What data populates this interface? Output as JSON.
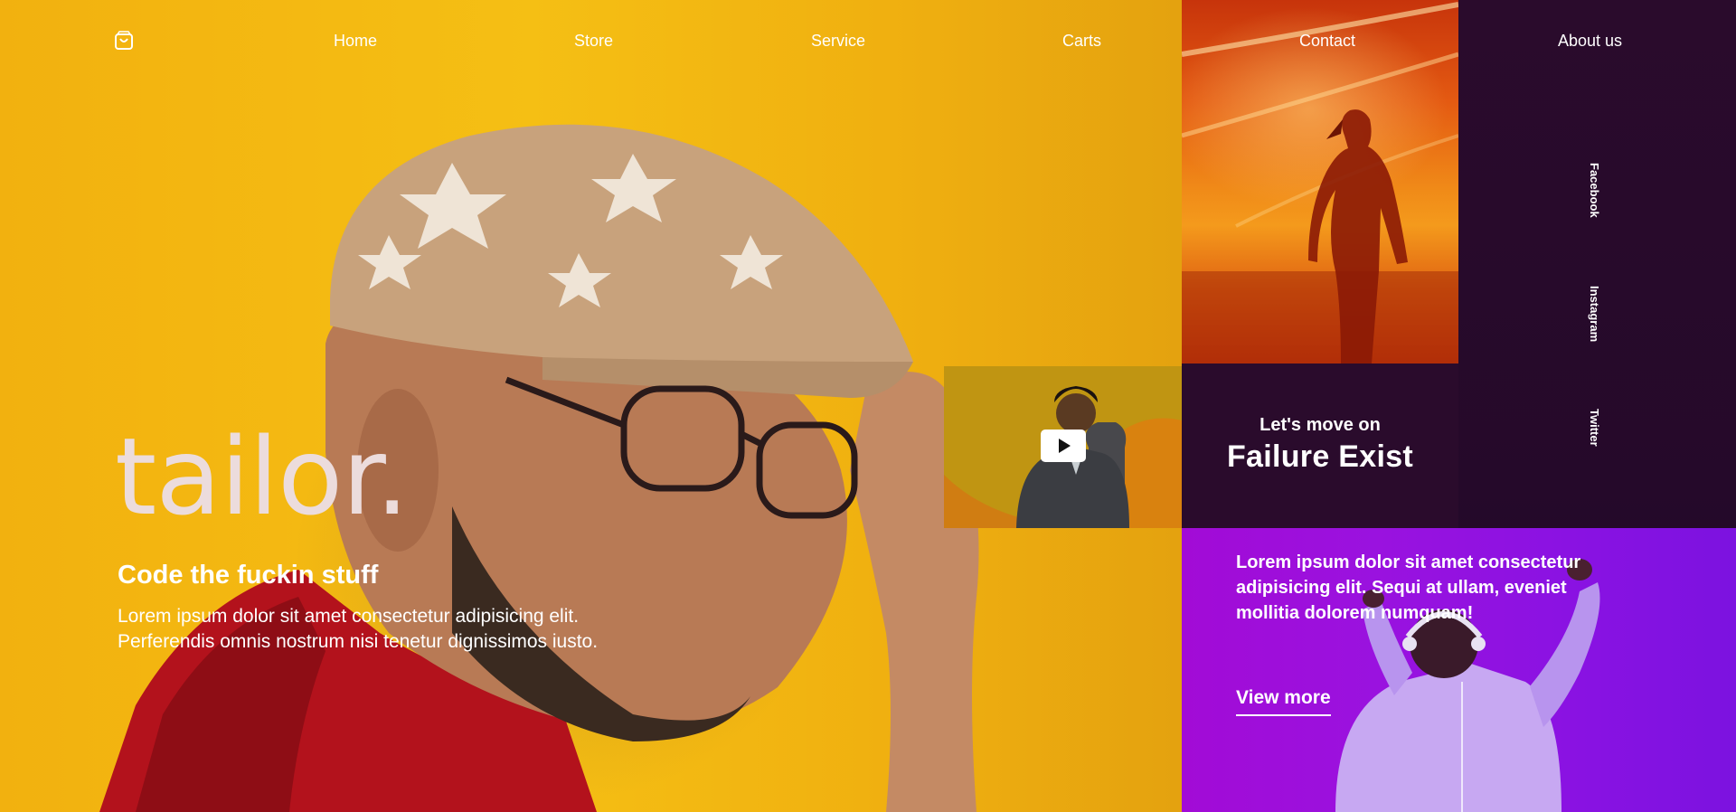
{
  "nav": {
    "cart_icon": "shopping-bag-icon",
    "links": [
      "Home",
      "Store",
      "Service",
      "Carts",
      "Contact",
      "About us"
    ]
  },
  "hero": {
    "brand": "tailor.",
    "tagline": "Code the fuckin stuff",
    "description_line1": "Lorem ipsum dolor sit amet consectetur adipisicing elit.",
    "description_line2": "Perferendis omnis nostrum nisi tenetur dignissimos iusto."
  },
  "video": {
    "play_icon": "play-icon"
  },
  "feature": {
    "kicker": "Let's move on",
    "headline": "Failure Exist"
  },
  "social": [
    "Facebook",
    "Instagram",
    "Twitter"
  ],
  "promo": {
    "text": "Lorem ipsum dolor sit amet consectetur adipisicing elit. Sequi at ullam, eveniet mollitia dolorem numquam!",
    "cta": "View more"
  },
  "colors": {
    "hero_yellow": "#f5bf14",
    "panel_dark": "#2a0b2c",
    "promo_purple": "#9a12df",
    "sunset_orange": "#e45a12"
  }
}
